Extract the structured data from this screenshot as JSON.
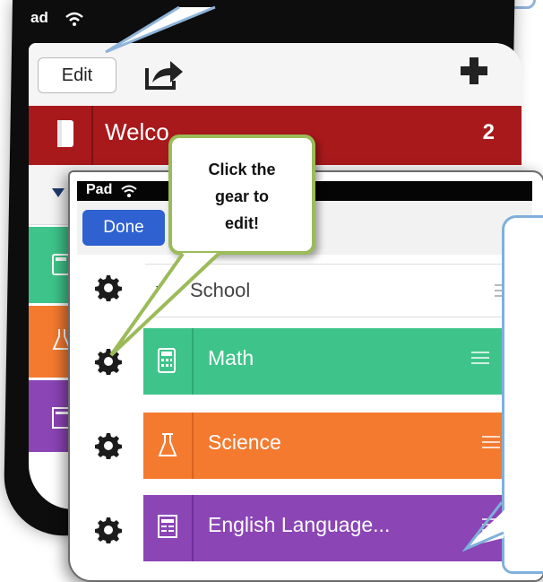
{
  "back_ipad": {
    "status_text": "ad",
    "edit_label": "Edit",
    "welcome_label": "Welco",
    "welcome_count": "2"
  },
  "front_ipad": {
    "status_text": "Pad",
    "done_label": "Done",
    "school_label": "School",
    "categories": [
      {
        "label": "Math",
        "color": "#3ec48a",
        "icon": "calculator-icon"
      },
      {
        "label": "Science",
        "color": "#f47a30",
        "icon": "flask-icon"
      },
      {
        "label": "English Language...",
        "color": "#8b45b5",
        "icon": "book-icon"
      }
    ]
  },
  "callout": {
    "text_line1": "Click the",
    "text_line2": "gear to",
    "text_line3": "edit!"
  },
  "colors": {
    "welcome_red": "#a8191c",
    "done_blue": "#2f61d1",
    "callout_green": "#9bbb59",
    "callout_blue": "#8fb4da"
  }
}
